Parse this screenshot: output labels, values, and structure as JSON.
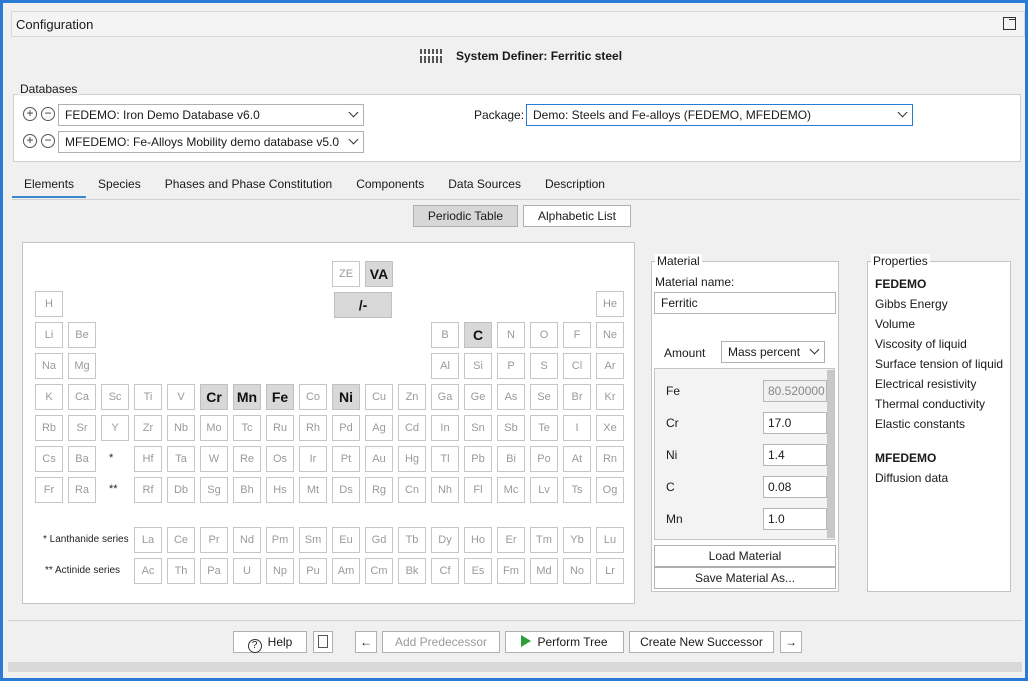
{
  "window": {
    "title": "Configuration"
  },
  "header": {
    "system_definer": "System Definer: Ferritic steel"
  },
  "databases": {
    "label": "Databases",
    "items": [
      "FEDEMO: Iron Demo Database v6.0",
      "MFEDEMO: Fe-Alloys Mobility demo database v5.0"
    ],
    "package_label": "Package:",
    "package_value": "Demo: Steels and Fe-alloys (FEDEMO, MFEDEMO)"
  },
  "tabs": [
    "Elements",
    "Species",
    "Phases and Phase Constitution",
    "Components",
    "Data Sources",
    "Description"
  ],
  "view_toggle": {
    "periodic": "Periodic Table",
    "alphabetic": "Alphabetic List"
  },
  "periodic": {
    "special": [
      "ZE",
      "VA",
      "/-"
    ],
    "rows": [
      [
        "H",
        "",
        "",
        "",
        "",
        "",
        "",
        "",
        "",
        "",
        "",
        "",
        "",
        "",
        "",
        "",
        "",
        "He"
      ],
      [
        "Li",
        "Be",
        "",
        "",
        "",
        "",
        "",
        "",
        "",
        "",
        "",
        "",
        "B",
        "C",
        "N",
        "O",
        "F",
        "Ne"
      ],
      [
        "Na",
        "Mg",
        "",
        "",
        "",
        "",
        "",
        "",
        "",
        "",
        "",
        "",
        "Al",
        "Si",
        "P",
        "S",
        "Cl",
        "Ar"
      ],
      [
        "K",
        "Ca",
        "Sc",
        "Ti",
        "V",
        "Cr",
        "Mn",
        "Fe",
        "Co",
        "Ni",
        "Cu",
        "Zn",
        "Ga",
        "Ge",
        "As",
        "Se",
        "Br",
        "Kr"
      ],
      [
        "Rb",
        "Sr",
        "Y",
        "Zr",
        "Nb",
        "Mo",
        "Tc",
        "Ru",
        "Rh",
        "Pd",
        "Ag",
        "Cd",
        "In",
        "Sn",
        "Sb",
        "Te",
        "I",
        "Xe"
      ],
      [
        "Cs",
        "Ba",
        "*",
        "Hf",
        "Ta",
        "W",
        "Re",
        "Os",
        "Ir",
        "Pt",
        "Au",
        "Hg",
        "Tl",
        "Pb",
        "Bi",
        "Po",
        "At",
        "Rn"
      ],
      [
        "Fr",
        "Ra",
        "**",
        "Rf",
        "Db",
        "Sg",
        "Bh",
        "Hs",
        "Mt",
        "Ds",
        "Rg",
        "Cn",
        "Nh",
        "Fl",
        "Mc",
        "Lv",
        "Ts",
        "Og"
      ]
    ],
    "lanthanide_label": "* Lanthanide series",
    "lanthanides": [
      "La",
      "Ce",
      "Pr",
      "Nd",
      "Pm",
      "Sm",
      "Eu",
      "Gd",
      "Tb",
      "Dy",
      "Ho",
      "Er",
      "Tm",
      "Yb",
      "Lu"
    ],
    "actinide_label": "** Actinide series",
    "actinides": [
      "Ac",
      "Th",
      "Pa",
      "U",
      "Np",
      "Pu",
      "Am",
      "Cm",
      "Bk",
      "Cf",
      "Es",
      "Fm",
      "Md",
      "No",
      "Lr"
    ],
    "selected": [
      "VA",
      "/-",
      "C",
      "Cr",
      "Mn",
      "Fe",
      "Ni"
    ]
  },
  "material": {
    "label": "Material",
    "name_label": "Material name:",
    "name_value": "Ferritic",
    "amount_label": "Amount",
    "amount_unit": "Mass percent",
    "composition": [
      {
        "el": "Fe",
        "val": "80.520000"
      },
      {
        "el": "Cr",
        "val": "17.0"
      },
      {
        "el": "Ni",
        "val": "1.4"
      },
      {
        "el": "C",
        "val": "0.08"
      },
      {
        "el": "Mn",
        "val": "1.0"
      }
    ],
    "load": "Load Material",
    "save": "Save Material As..."
  },
  "properties": {
    "label": "Properties",
    "groups": [
      {
        "db": "FEDEMO",
        "items": [
          "Gibbs Energy",
          "Volume",
          "Viscosity of liquid",
          "Surface tension of liquid",
          "Electrical resistivity",
          "Thermal conductivity",
          "Elastic constants"
        ]
      },
      {
        "db": "MFEDEMO",
        "items": [
          "Diffusion data"
        ]
      }
    ]
  },
  "footer": {
    "help": "Help",
    "add_predecessor": "Add Predecessor",
    "perform_tree": "Perform Tree",
    "create_successor": "Create New Successor"
  }
}
